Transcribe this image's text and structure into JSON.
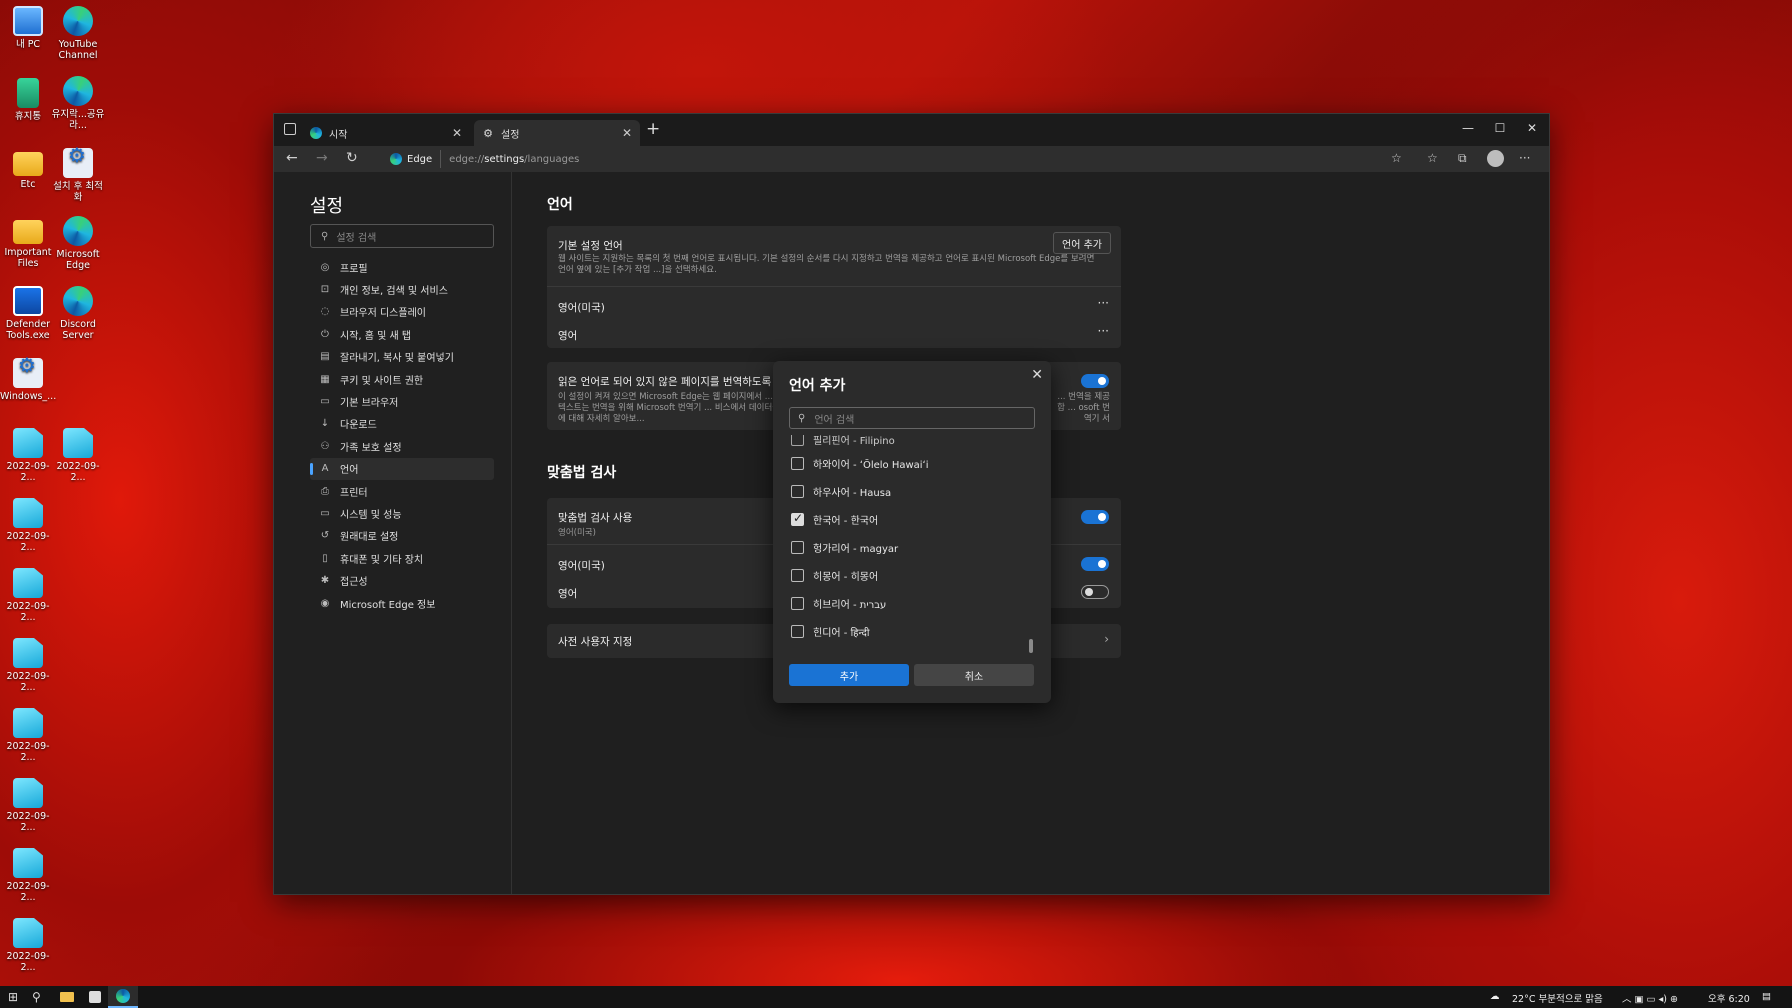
{
  "desktop": {
    "icons": [
      {
        "label": "내 PC",
        "icon": "pc-icon"
      },
      {
        "label": "YouTube Channel",
        "icon": "edge-icon"
      },
      {
        "label": "휴지통",
        "icon": "recycle-bin-icon"
      },
      {
        "label": "유지락...공유라...",
        "icon": "edge-icon"
      },
      {
        "label": "Etc",
        "icon": "folder-icon"
      },
      {
        "label": "설치 후 최적화",
        "icon": "gear-icon"
      },
      {
        "label": "Important Files",
        "icon": "folder-icon"
      },
      {
        "label": "Microsoft Edge",
        "icon": "edge-icon"
      },
      {
        "label": "Defender Tools.exe",
        "icon": "shield-icon"
      },
      {
        "label": "Discord Server",
        "icon": "edge-icon"
      },
      {
        "label": "Windows_...",
        "icon": "gear-icon"
      },
      {
        "label": "2022-09-2...",
        "icon": "image-icon"
      },
      {
        "label": "2022-09-2...",
        "icon": "image-icon"
      },
      {
        "label": "2022-09-2...",
        "icon": "image-icon"
      },
      {
        "label": "2022-09-2...",
        "icon": "image-icon"
      },
      {
        "label": "2022-09-2...",
        "icon": "image-icon"
      },
      {
        "label": "2022-09-2...",
        "icon": "image-icon"
      },
      {
        "label": "2022-09-2...",
        "icon": "image-icon"
      },
      {
        "label": "2022-09-2...",
        "icon": "image-icon"
      },
      {
        "label": "2022-09-2...",
        "icon": "image-icon"
      }
    ]
  },
  "browser": {
    "tabs": [
      {
        "label": "시작",
        "active": false
      },
      {
        "label": "설정",
        "active": true
      }
    ],
    "address": {
      "site_chip": "Edge",
      "url_prefix": "edge://",
      "url_main": "settings",
      "url_suffix": "/languages"
    }
  },
  "settings": {
    "title": "설정",
    "search_placeholder": "설정 검색",
    "nav": [
      {
        "label": "프로필",
        "icon": "profile-icon"
      },
      {
        "label": "개인 정보, 검색 및 서비스",
        "icon": "lock-icon"
      },
      {
        "label": "브라우저 디스플레이",
        "icon": "appearance-icon"
      },
      {
        "label": "시작, 홈 및 새 탭",
        "icon": "power-icon"
      },
      {
        "label": "잘라내기, 복사 및 붙여넣기",
        "icon": "clipboard-icon"
      },
      {
        "label": "쿠키 및 사이트 권한",
        "icon": "cookie-icon"
      },
      {
        "label": "기본 브라우저",
        "icon": "browser-icon"
      },
      {
        "label": "다운로드",
        "icon": "download-icon"
      },
      {
        "label": "가족 보호 설정",
        "icon": "family-icon"
      },
      {
        "label": "언어",
        "icon": "language-icon",
        "active": true
      },
      {
        "label": "프린터",
        "icon": "printer-icon"
      },
      {
        "label": "시스템 및 성능",
        "icon": "system-icon"
      },
      {
        "label": "원래대로 설정",
        "icon": "reset-icon"
      },
      {
        "label": "휴대폰 및 기타 장치",
        "icon": "phone-icon"
      },
      {
        "label": "접근성",
        "icon": "accessibility-icon"
      },
      {
        "label": "Microsoft Edge 정보",
        "icon": "edge-icon"
      }
    ],
    "language_section": {
      "heading": "언어",
      "preferred_title": "기본 설정 언어",
      "add_language_button": "언어 추가",
      "preferred_desc": "웹 사이트는 지원하는 목록의 첫 번째 언어로 표시됩니다. 기본 설정의 순서를 다시 지정하고 번역을 제공하고 언어로 표시된 Microsoft Edge를 보려면 언어 옆에 있는 [추가 작업 ...]을 선택하세요.",
      "languages": [
        "영어(미국)",
        "영어"
      ],
      "translate_title": "읽은 언어로 되어 있지 않은 페이지를 번역하도록 제안",
      "translate_desc_left": "이 설정이 켜져 있으면 Microsoft Edge는 웹 페이지에서 ... 니다. 웹 페이지 텍스트는 번역을 위해 Microsoft 번역기 ... 비스에서 데이터를 사용하는 방법에 대해 자세히 알아보...",
      "translate_desc_right": "... 번역을 제공합 ... osoft 번역기 서"
    },
    "spellcheck_section": {
      "heading": "맞춤법 검사",
      "enable_title": "맞춤법 검사 사용",
      "enable_sub": "영어(미국)",
      "rows": [
        "영어(미국)",
        "영어"
      ],
      "custom_dictionary": "사전 사용자 지정"
    }
  },
  "dialog": {
    "title": "언어 추가",
    "search_placeholder": "언어 검색",
    "items": [
      {
        "label": "필리핀어 - Filipino",
        "checked": false
      },
      {
        "label": "하와이어 - ʻŌlelo Hawaiʻi",
        "checked": false
      },
      {
        "label": "하우사어 - Hausa",
        "checked": false
      },
      {
        "label": "한국어 - 한국어",
        "checked": true
      },
      {
        "label": "헝가리어 - magyar",
        "checked": false
      },
      {
        "label": "히몽어 - 히몽어",
        "checked": false
      },
      {
        "label": "히브리어 - עברית",
        "checked": false
      },
      {
        "label": "힌디어 - हिन्दी",
        "checked": false
      }
    ],
    "add_button": "추가",
    "cancel_button": "취소"
  },
  "taskbar": {
    "weather": "22°C 부분적으로 맑음",
    "time": "오후 6:20"
  }
}
